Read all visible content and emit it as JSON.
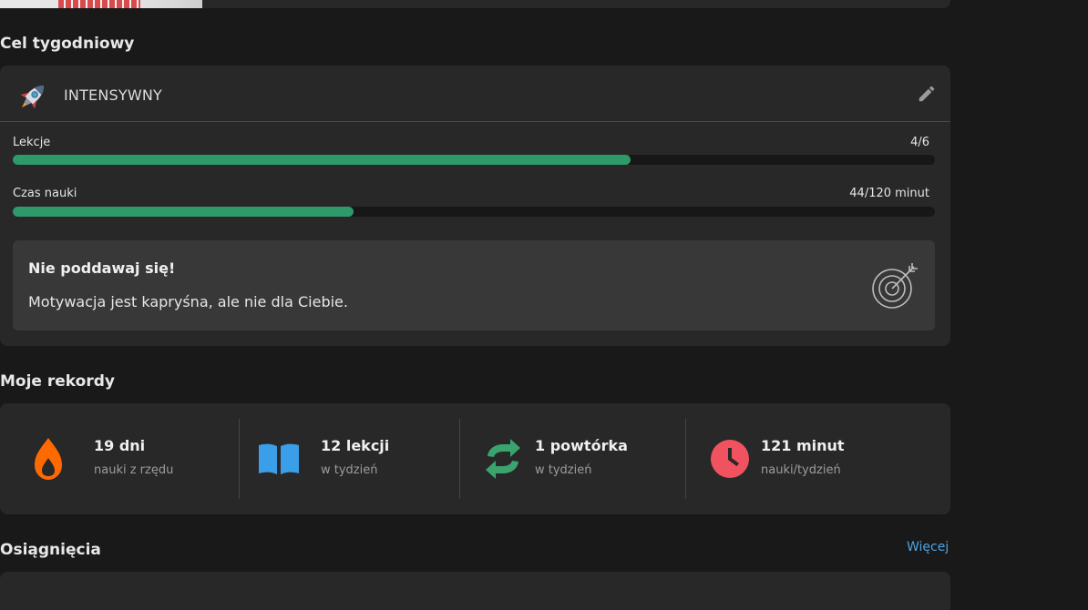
{
  "goal_section": {
    "title": "Cel tygodniowy",
    "goal_name": "INTENSYWNY",
    "progress": [
      {
        "label": "Lekcje",
        "value_text": "4/6",
        "fraction": 0.67
      },
      {
        "label": "Czas nauki",
        "value_text": "44/120 minut",
        "fraction": 0.37
      }
    ],
    "motivation": {
      "title": "Nie poddawaj się!",
      "text": "Motywacja jest kapryśna, ale nie dla Ciebie."
    },
    "accent_color": "#2e9a6a"
  },
  "records_section": {
    "title": "Moje rekordy",
    "items": [
      {
        "value": "19 dni",
        "sub": "nauki z rzędu",
        "icon": "flame-icon",
        "color": "#ff6a00"
      },
      {
        "value": "12 lekcji",
        "sub": "w tydzień",
        "icon": "book-icon",
        "color": "#3a9fe8"
      },
      {
        "value": "1 powtórka",
        "sub": "w tydzień",
        "icon": "repeat-icon",
        "color": "#3aa36e"
      },
      {
        "value": "121 minut",
        "sub": "nauki/tydzień",
        "icon": "clock-icon",
        "color": "#f0535f"
      }
    ]
  },
  "achievements_section": {
    "title": "Osiągnięcia",
    "more_label": "Więcej"
  }
}
